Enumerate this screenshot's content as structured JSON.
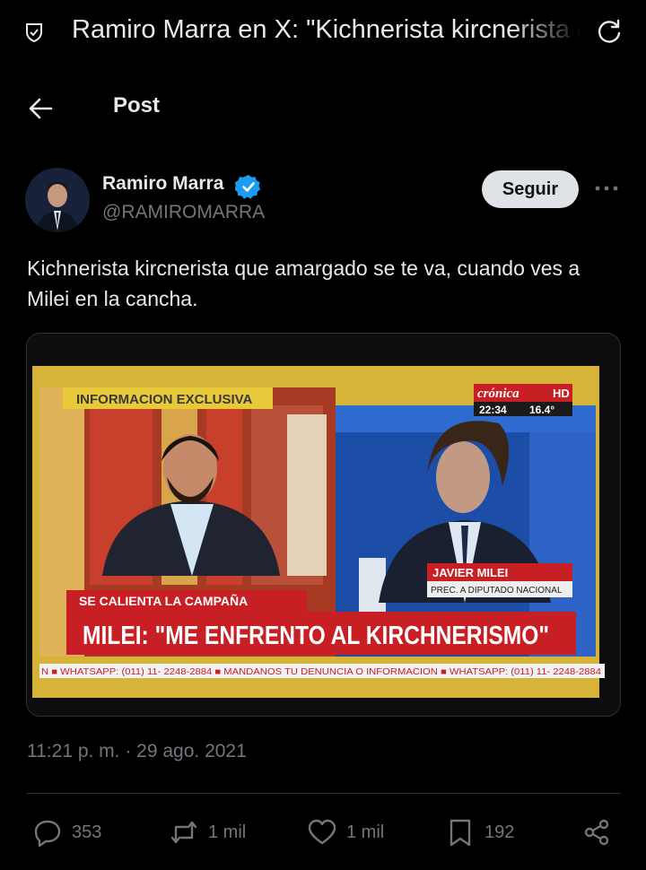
{
  "browser": {
    "title": "Ramiro Marra en X: \"Kichnerista kircnerista que amargado se te va, cuando ves a Milei en la cancha\""
  },
  "header": {
    "label": "Post"
  },
  "author": {
    "name": "Ramiro Marra",
    "handle": "@RAMIROMARRA",
    "follow_label": "Seguir"
  },
  "tweet": {
    "text": "Kichnerista kircnerista que amargado se te va, cuando ves a Milei en la cancha.",
    "timestamp": "11:21 p. m. · 29 ago. 2021"
  },
  "media": {
    "banner_top": "INFORMACION EXCLUSIVA",
    "channel_logo": "crónica",
    "channel_hd": "HD",
    "clock": "22:34",
    "temperature": "16.4°",
    "name_plate": "JAVIER MILEI",
    "name_subtitle": "PREC. A DIPUTADO NACIONAL",
    "strap": "SE CALIENTA LA CAMPAÑA",
    "headline": "MILEI: \"ME ENFRENTO AL KIRCHNERISMO\"",
    "ticker": "N ■ WHATSAPP: (011) 11- 2248-2884 ■ MANDANOS TU DENUNCIA O INFORMACION ■ WHATSAPP: (011) 11- 2248-2884"
  },
  "actions": {
    "replies": "353",
    "reposts": "1 mil",
    "likes": "1 mil",
    "bookmarks": "192"
  },
  "colors": {
    "background": "#000000",
    "text_primary": "#e7e9ea",
    "text_secondary": "#71767b",
    "verified": "#1d9bf0",
    "follow_bg": "#dfe3e7",
    "tv_red": "#c81f24",
    "tv_yellow": "#e8c93a"
  }
}
